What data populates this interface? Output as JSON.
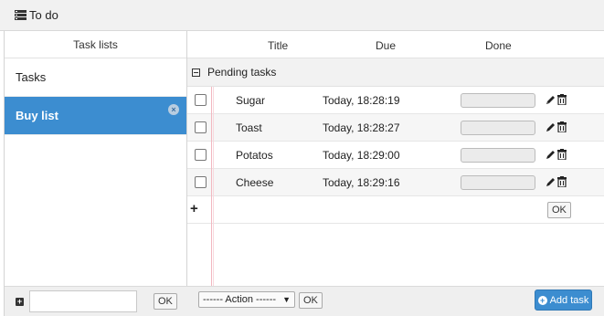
{
  "window": {
    "title": "To do",
    "icon": "list-icon"
  },
  "task_lists": {
    "header": "Task lists",
    "items": [
      {
        "label": "Tasks",
        "selected": false
      },
      {
        "label": "Buy list",
        "selected": true
      }
    ],
    "remove_icon_glyph": "×",
    "new_list_input": {
      "value": "",
      "placeholder": ""
    },
    "ok_label": "OK",
    "add_icon_glyph": "+"
  },
  "tasks": {
    "columns": {
      "title": "Title",
      "due": "Due",
      "done": "Done"
    },
    "group_label": "Pending tasks",
    "rows": [
      {
        "title": "Sugar",
        "due": "Today, 18:28:19",
        "done": false
      },
      {
        "title": "Toast",
        "due": "Today, 18:28:27",
        "done": false
      },
      {
        "title": "Potatos",
        "due": "Today, 18:29:00",
        "done": false
      },
      {
        "title": "Cheese",
        "due": "Today, 18:29:16",
        "done": false
      }
    ],
    "add_row": {
      "plus_glyph": "+",
      "ok_label": "OK"
    }
  },
  "footer": {
    "action_select": "------ Action ------",
    "ok_label": "OK",
    "add_task_label": "Add task",
    "add_task_glyph": "+"
  },
  "colors": {
    "accent": "#3c8dd0",
    "header_bg": "#f1f1f1",
    "red_margin_line": "#f2b8c0"
  }
}
